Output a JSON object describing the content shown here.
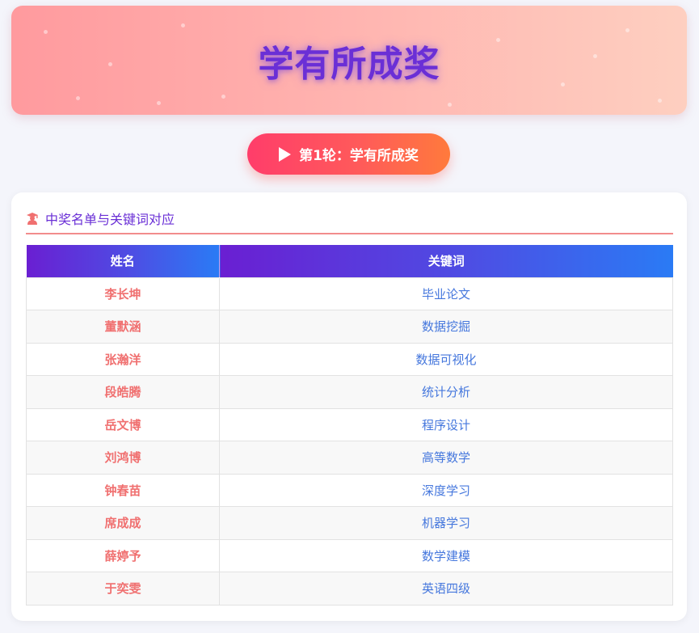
{
  "banner": {
    "title": "学有所成奖"
  },
  "round_button": {
    "label": "第1轮：学有所成奖"
  },
  "card": {
    "title": "中奖名单与关键词对应",
    "columns": [
      "姓名",
      "关键词"
    ],
    "rows": [
      {
        "name": "李长坤",
        "keyword": "毕业论文"
      },
      {
        "name": "董默涵",
        "keyword": "数据挖掘"
      },
      {
        "name": "张瀚洋",
        "keyword": "数据可视化"
      },
      {
        "name": "段皓腾",
        "keyword": "统计分析"
      },
      {
        "name": "岳文博",
        "keyword": "程序设计"
      },
      {
        "name": "刘鸿博",
        "keyword": "高等数学"
      },
      {
        "name": "钟春苗",
        "keyword": "深度学习"
      },
      {
        "name": "席成成",
        "keyword": "机器学习"
      },
      {
        "name": "薛婷予",
        "keyword": "数学建模"
      },
      {
        "name": "于奕雯",
        "keyword": "英语四级"
      }
    ]
  },
  "icons": {
    "round_button": "play-icon",
    "card_title": "graduate-icon"
  },
  "colors": {
    "title": "#6a2fd6",
    "name_text": "#f07070",
    "keyword_text": "#4577dd",
    "header_gradient_start": "#6a1fd2",
    "header_gradient_end": "#2a7bf5"
  }
}
